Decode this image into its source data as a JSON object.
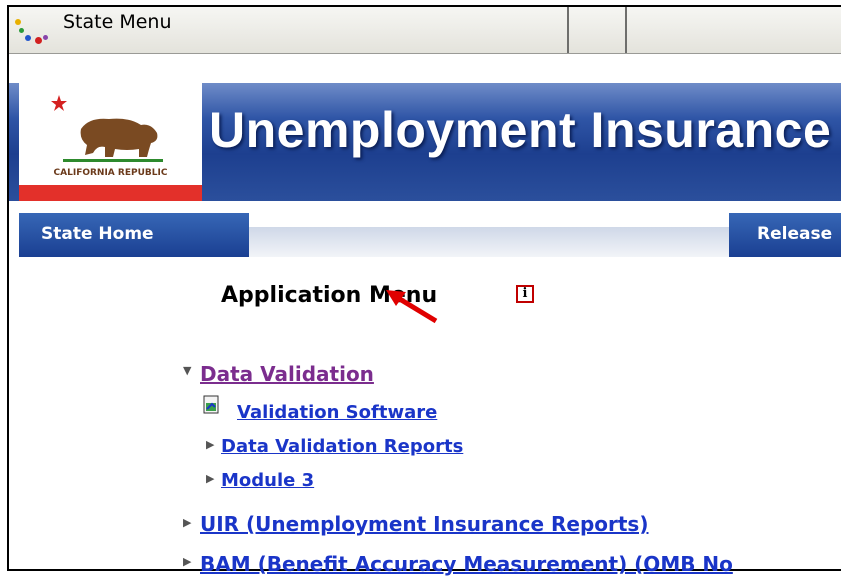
{
  "window": {
    "tab_title": "State Menu"
  },
  "banner": {
    "title": "Unemployment Insurance",
    "flag_text": "CALIFORNIA REPUBLIC"
  },
  "nav": {
    "home": "State Home",
    "release": "Release"
  },
  "page": {
    "title": "Application Menu",
    "info_symbol": "i"
  },
  "menu": {
    "data_validation": "Data Validation",
    "validation_software": "Validation Software",
    "data_validation_reports": "Data Validation Reports",
    "module3": "Module 3",
    "uir": "UIR (Unemployment Insurance Reports)",
    "bam": "BAM (Benefit Accuracy Measurement) (OMB No"
  },
  "colors": {
    "link": "#1a35c8",
    "visited_link": "#7b2d8e",
    "banner": "#1d3f8f",
    "annotation_arrow": "#e00000"
  }
}
